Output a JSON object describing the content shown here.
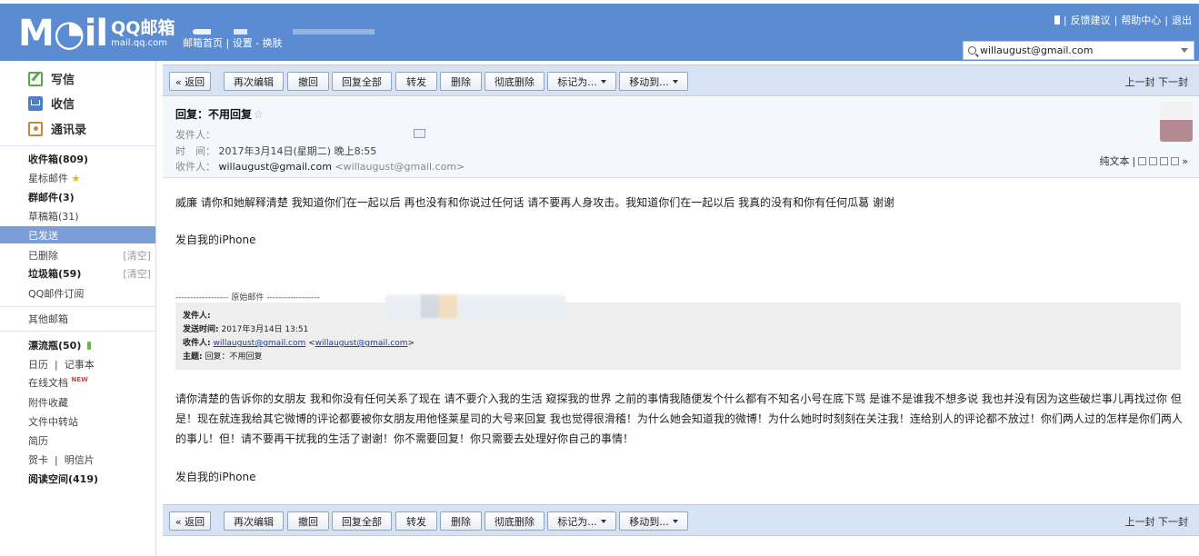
{
  "header": {
    "logo_mark": "M◔il",
    "logo_name": "QQ邮箱",
    "logo_domain": "mail.qq.com",
    "nav": [
      "邮箱首页",
      "设置",
      "换肤"
    ],
    "top_links": [
      "反馈建议",
      "帮助中心",
      "退出"
    ],
    "account": "willaugust@gmail.com"
  },
  "sidebar": {
    "write": "写信",
    "receive": "收信",
    "contacts": "通讯录",
    "inbox": "收件箱(809)",
    "starred": "星标邮件",
    "group": "群邮件(3)",
    "drafts": "草稿箱(31)",
    "sent": "已发送",
    "deleted": "已删除",
    "junk": "垃圾箱(59)",
    "clear": "[清空]",
    "subscriptions": "QQ邮件订阅",
    "other": "其他邮箱",
    "bottle": "漂流瓶(50)",
    "calendar": "日历",
    "notes": "记事本",
    "docs": "在线文档",
    "new_tag": "NEW",
    "attachments": "附件收藏",
    "transfer": "文件中转站",
    "resume": "简历",
    "cards": "贺卡",
    "postcards": "明信片",
    "reading": "阅读空间(419)"
  },
  "toolbar": {
    "back": "« 返回",
    "reedit": "再次编辑",
    "recall": "撤回",
    "reply_all": "回复全部",
    "forward": "转发",
    "delete": "删除",
    "perm_delete": "彻底删除",
    "mark_as": "标记为...",
    "move_to": "移动到...",
    "prev": "上一封",
    "next": "下一封"
  },
  "mail": {
    "subject": "回复：不用回复",
    "sender_label": "发件人：",
    "time_label": "时　间：",
    "time": "2017年3月14日(星期二) 晚上8:55",
    "recipient_label": "收件人：",
    "recipient_name": "willaugust@gmail.com",
    "recipient_addr": "<willaugust@gmail.com>",
    "plain_text": "纯文本",
    "body_1": "威廉 请你和她解释清楚 我知道你们在一起以后 再也没有和你说过任何话 请不要再人身攻击。我知道你们在一起以后 我真的没有和你有任何瓜葛 谢谢",
    "signature": "发自我的iPhone",
    "original_sep": "------------------ 原始邮件 ------------------",
    "orig_sender_label": "发件人:",
    "orig_time_label": "发送时间:",
    "orig_time": "2017年3月14日 13:51",
    "orig_to_label": "收件人:",
    "orig_to_name": "willaugust@gmail.com",
    "orig_to_addr": "willaugust@gmail.com",
    "orig_subject_label": "主题:",
    "orig_subject": "回复：不用回复",
    "body_2": "请你清楚的告诉你的女朋友 我和你没有任何关系了现在 请不要介入我的生活 窥探我的世界 之前的事情我随便发个什么都有不知名小号在底下骂 是谁不是谁我不想多说 我也并没有因为这些破烂事儿再找过你 但是！现在就连我给其它微博的评论都要被你女朋友用他怪莱星司的大号来回复 我也觉得很滑稽！为什么她会知道我的微博！为什么她时时刻刻在关注我！连给别人的评论都不放过！你们两人过的怎样是你们两人的事儿！但！请不要再干扰我的生活了谢谢！你不需要回复！你只需要去处理好你自己的事情！",
    "signature_2": "发自我的iPhone"
  }
}
